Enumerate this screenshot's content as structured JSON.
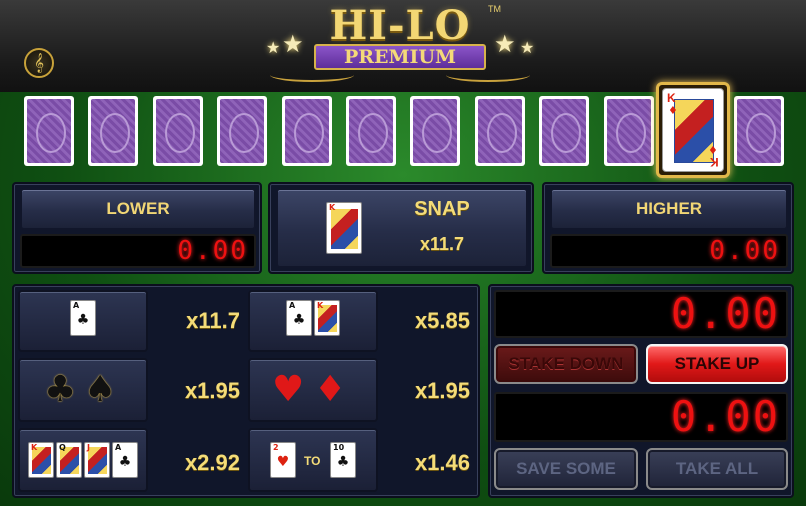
{
  "header": {
    "title": "HI-LO",
    "tm": "TM",
    "subtitle": "PREMIUM",
    "music_icon": "music-note-icon",
    "music_glyph": "𝄞"
  },
  "cards": {
    "face_down_count": 10,
    "current": {
      "rank": "K",
      "suit": "♦",
      "color": "#dd2211"
    },
    "next_face_down": 1
  },
  "lower": {
    "label": "LOWER",
    "value": "0.00"
  },
  "snap": {
    "label": "SNAP",
    "multiplier": "x11.7",
    "card_rank": "K",
    "card_suit": "♦"
  },
  "higher": {
    "label": "HIGHER",
    "value": "0.00"
  },
  "side_bets": [
    {
      "id": "ace",
      "multiplier": "x11.7",
      "cards": [
        {
          "r": "A",
          "s": "♣",
          "c": "#111"
        }
      ]
    },
    {
      "id": "ace-pair",
      "multiplier": "x5.85",
      "cards": [
        {
          "r": "A",
          "s": "♣",
          "c": "#111"
        },
        {
          "r": "K",
          "s": "♦",
          "c": "#d21"
        }
      ]
    },
    {
      "id": "black",
      "multiplier": "x1.95",
      "suits": [
        {
          "s": "♣",
          "c": "#111"
        },
        {
          "s": "♠",
          "c": "#111"
        }
      ]
    },
    {
      "id": "red",
      "multiplier": "x1.95",
      "suits": [
        {
          "s": "♥",
          "c": "#e01818"
        },
        {
          "s": "♦",
          "c": "#e01818"
        }
      ]
    },
    {
      "id": "picture",
      "multiplier": "x2.92",
      "cards": [
        {
          "r": "K",
          "s": "",
          "c": "#d21"
        },
        {
          "r": "Q",
          "s": "",
          "c": "#111"
        },
        {
          "r": "J",
          "s": "",
          "c": "#d21"
        },
        {
          "r": "A",
          "s": "♣",
          "c": "#111"
        }
      ]
    },
    {
      "id": "number",
      "multiplier": "x1.46",
      "from": {
        "r": "2",
        "s": "♥",
        "c": "#d21"
      },
      "to_label": "TO",
      "to": {
        "r": "10",
        "s": "♣",
        "c": "#111"
      }
    }
  ],
  "stake": {
    "stake_value": "0.00",
    "win_value": "0.00",
    "stake_down": "STAKE DOWN",
    "stake_up": "STAKE UP",
    "save_some": "SAVE SOME",
    "take_all": "TAKE ALL"
  },
  "colors": {
    "felt": "#1d6e1f",
    "gold": "#f1d675",
    "led": "#ee1111",
    "panel": "#10162a"
  }
}
